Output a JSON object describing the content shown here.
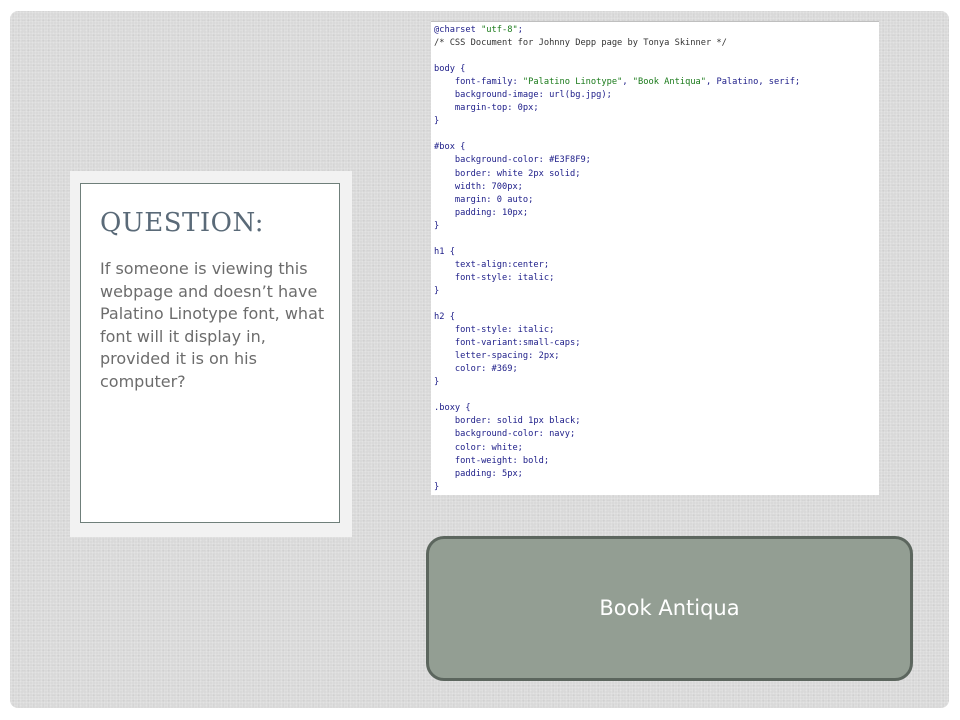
{
  "question": {
    "title": "QUESTION:",
    "body": "If someone is viewing this webpage and doesn’t have Palatino Linotype font, what font will it display in, provided it is on his computer?"
  },
  "code": {
    "lines": [
      "@charset \"utf-8\";",
      "/* CSS Document for Johnny Depp page by Tonya Skinner */",
      "",
      "body {",
      "    font-family: \"Palatino Linotype\", \"Book Antiqua\", Palatino, serif;",
      "    background-image: url(bg.jpg);",
      "    margin-top: 0px;",
      "}",
      "",
      "#box {",
      "    background-color: #E3F8F9;",
      "    border: white 2px solid;",
      "    width: 700px;",
      "    margin: 0 auto;",
      "    padding: 10px;",
      "}",
      "",
      "h1 {",
      "    text-align:center;",
      "    font-style: italic;",
      "}",
      "",
      "h2 {",
      "    font-style: italic;",
      "    font-variant:small-caps;",
      "    letter-spacing: 2px;",
      "    color: #369;",
      "}",
      "",
      ".boxy {",
      "    border: solid 1px black;",
      "    background-color: navy;",
      "    color: white;",
      "    font-weight: bold;",
      "    padding: 5px;",
      "}"
    ]
  },
  "answer": {
    "label": "Book Antiqua"
  },
  "colors": {
    "slide_background": "#d9d9d9",
    "title_color": "#5a6a78",
    "body_text_color": "#6c6c6c",
    "answer_fill": "#939e93",
    "answer_border": "#5c665e",
    "answer_text": "#ffffff",
    "code_text": "#1d1d98",
    "code_string": "#1a7a1a"
  }
}
